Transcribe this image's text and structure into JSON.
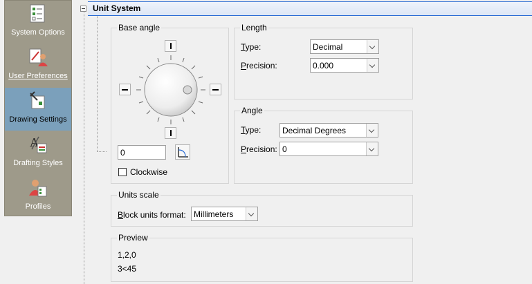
{
  "sidebar": {
    "items": [
      {
        "label": "System Options",
        "icon": "system-options-icon",
        "selected": false
      },
      {
        "label": "User Preferences",
        "icon": "user-preferences-icon",
        "selected": false
      },
      {
        "label": "Drawing Settings",
        "icon": "drawing-settings-icon",
        "selected": true
      },
      {
        "label": "Drafting Styles",
        "icon": "drafting-styles-icon",
        "selected": false
      },
      {
        "label": "Profiles",
        "icon": "profiles-icon",
        "selected": false
      }
    ]
  },
  "section": {
    "title": "Unit System"
  },
  "base_angle": {
    "title": "Base angle",
    "value": "0",
    "clockwise_label": "Clockwise",
    "clockwise_checked": false
  },
  "length": {
    "title": "Length",
    "type_label_accel": "T",
    "type_label_rest": "ype:",
    "type_value": "Decimal",
    "precision_label_accel": "P",
    "precision_label_rest": "recision:",
    "precision_value": "0.000"
  },
  "angle": {
    "title": "Angle",
    "type_label_accel": "T",
    "type_label_rest": "ype:",
    "type_value": "Decimal Degrees",
    "precision_label_accel": "P",
    "precision_label_rest": "recision:",
    "precision_value": "0"
  },
  "units_scale": {
    "title": "Units scale",
    "block_label_accel": "B",
    "block_label_rest": "lock units format:",
    "block_value": "Millimeters"
  },
  "preview": {
    "title": "Preview",
    "line1": "1,2,0",
    "line2": "3<45"
  }
}
